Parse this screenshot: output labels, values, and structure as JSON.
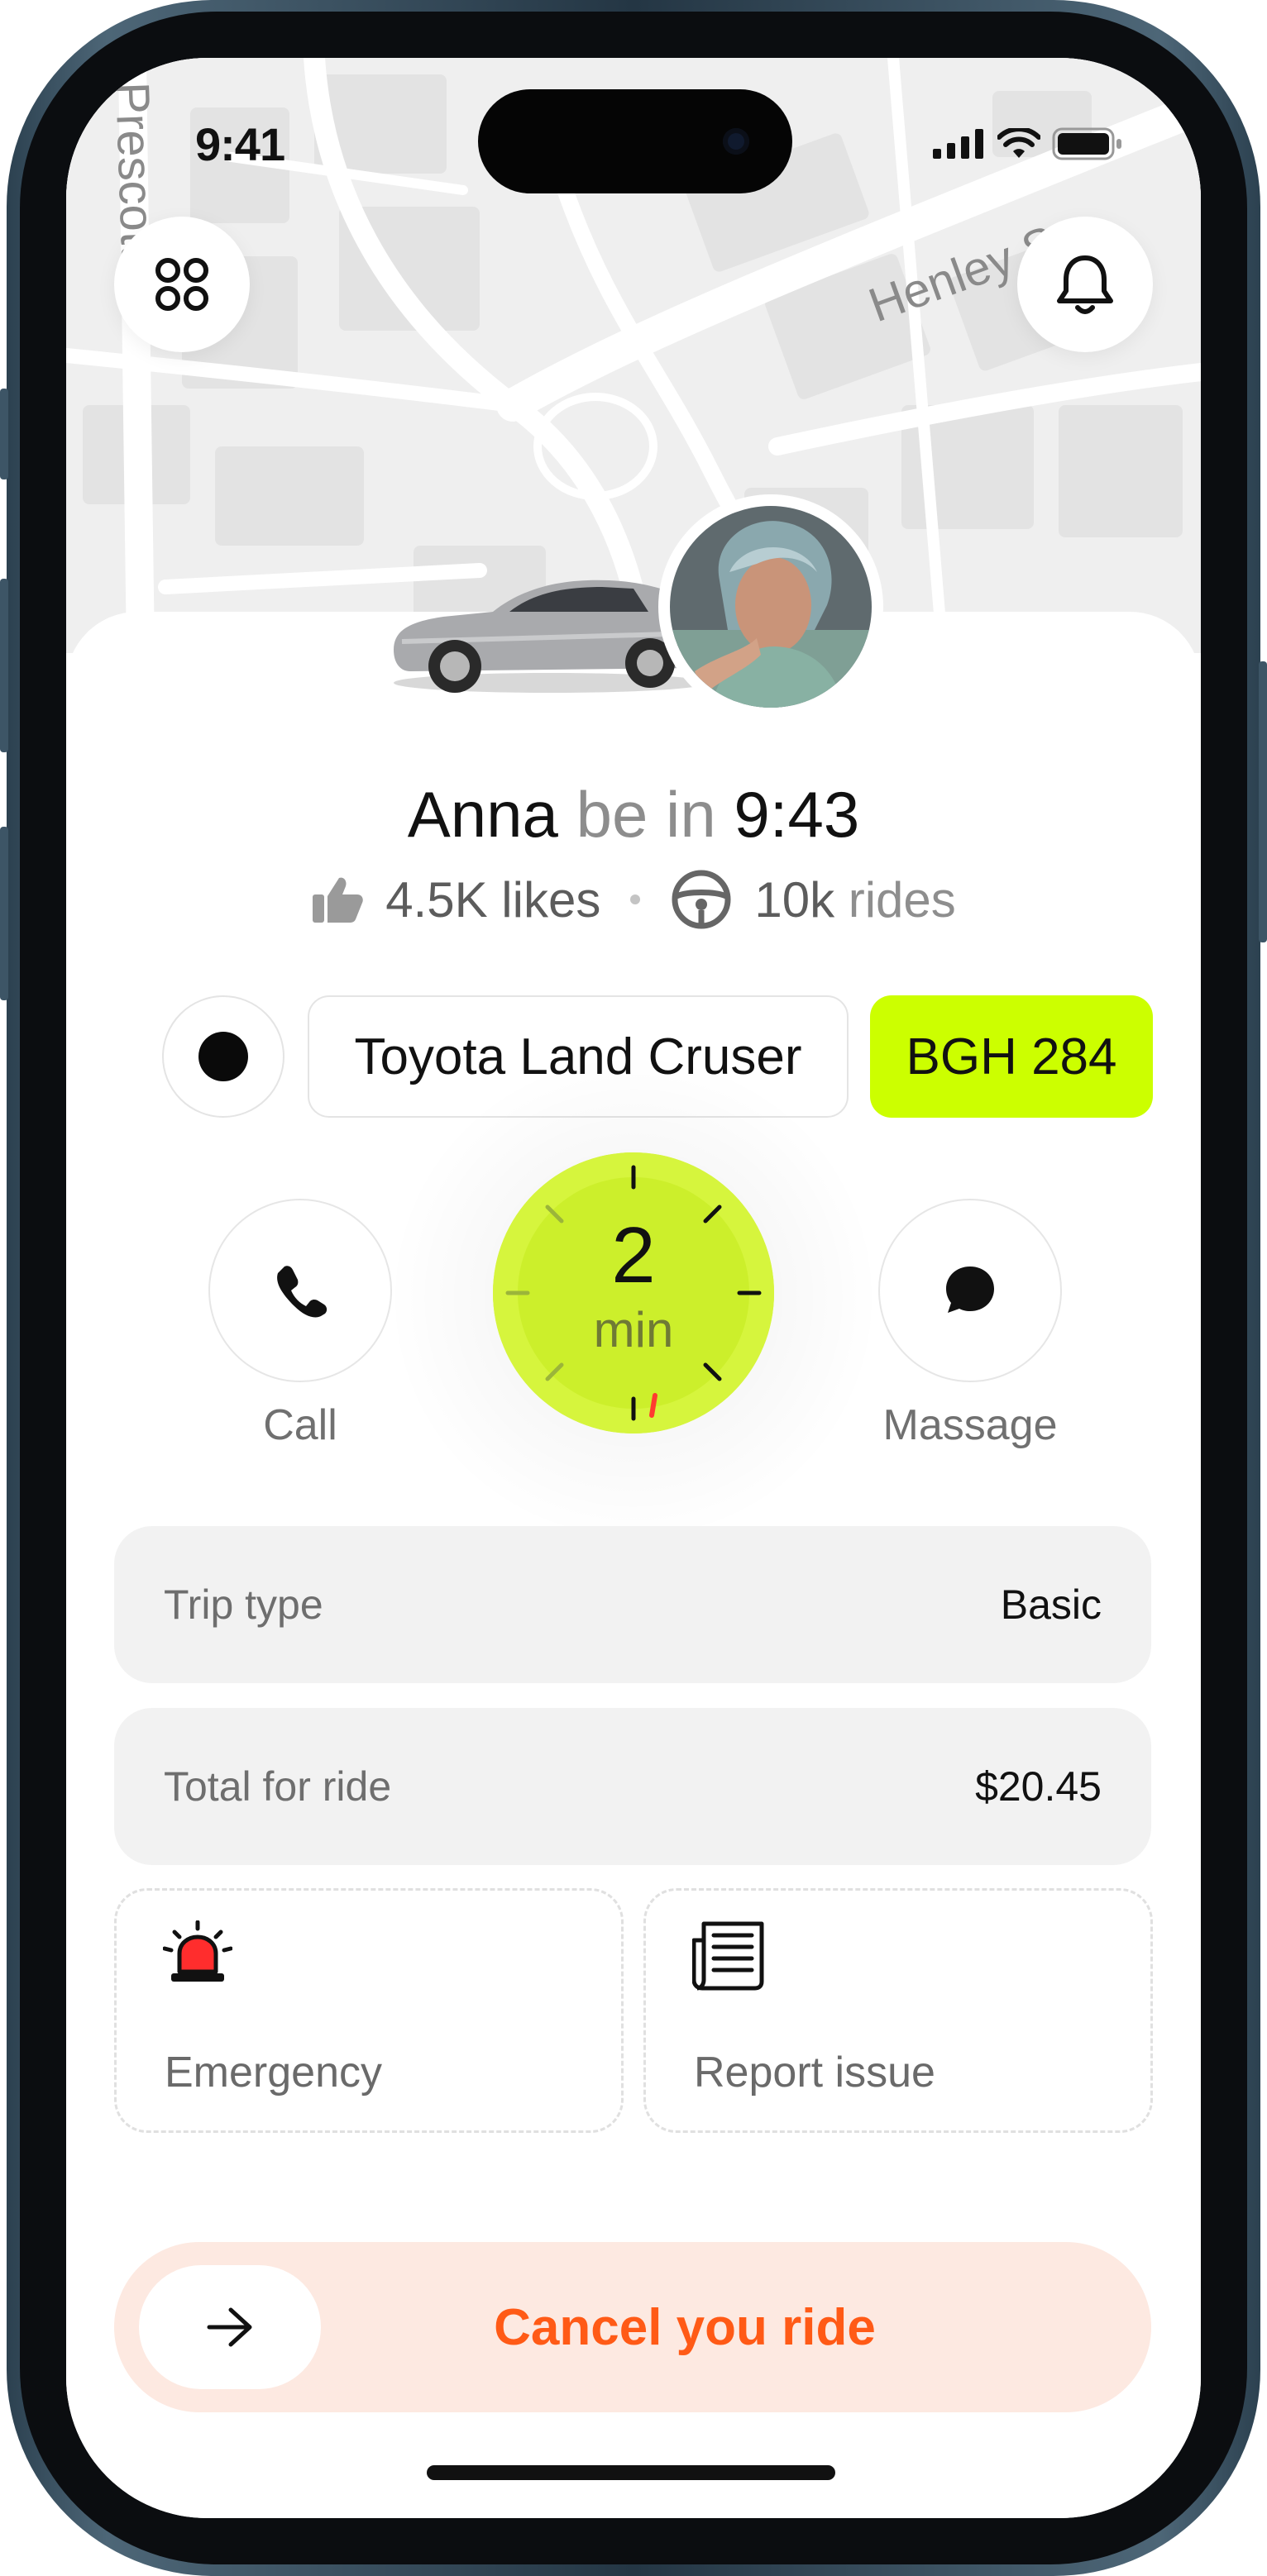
{
  "status_bar": {
    "time": "9:41"
  },
  "map": {
    "street_1": "Henley St",
    "street_2": "Prescott St"
  },
  "driver": {
    "name": "Anna",
    "arrival_phrase": "be in",
    "arrival_time": "9:43",
    "likes": "4.5K likes",
    "rides_count": "10k",
    "rides_label": "rides"
  },
  "vehicle": {
    "model": "Toyota Land Cruser",
    "plate": "BGH 284",
    "color": "#0a0a0a"
  },
  "actions": {
    "call_label": "Call",
    "message_label": "Massage"
  },
  "timer": {
    "value": "2",
    "unit": "min"
  },
  "trip": {
    "type_label": "Trip type",
    "type_value": "Basic",
    "total_label": "Total for ride",
    "total_value": "$20.45"
  },
  "tiles": {
    "emergency_label": "Emergency",
    "report_label": "Report issue"
  },
  "cancel": {
    "label": "Cancel you ride"
  },
  "colors": {
    "accent_lime": "#ccff00",
    "cancel_orange": "#ff5a16",
    "cancel_bg": "#fde9e1"
  }
}
